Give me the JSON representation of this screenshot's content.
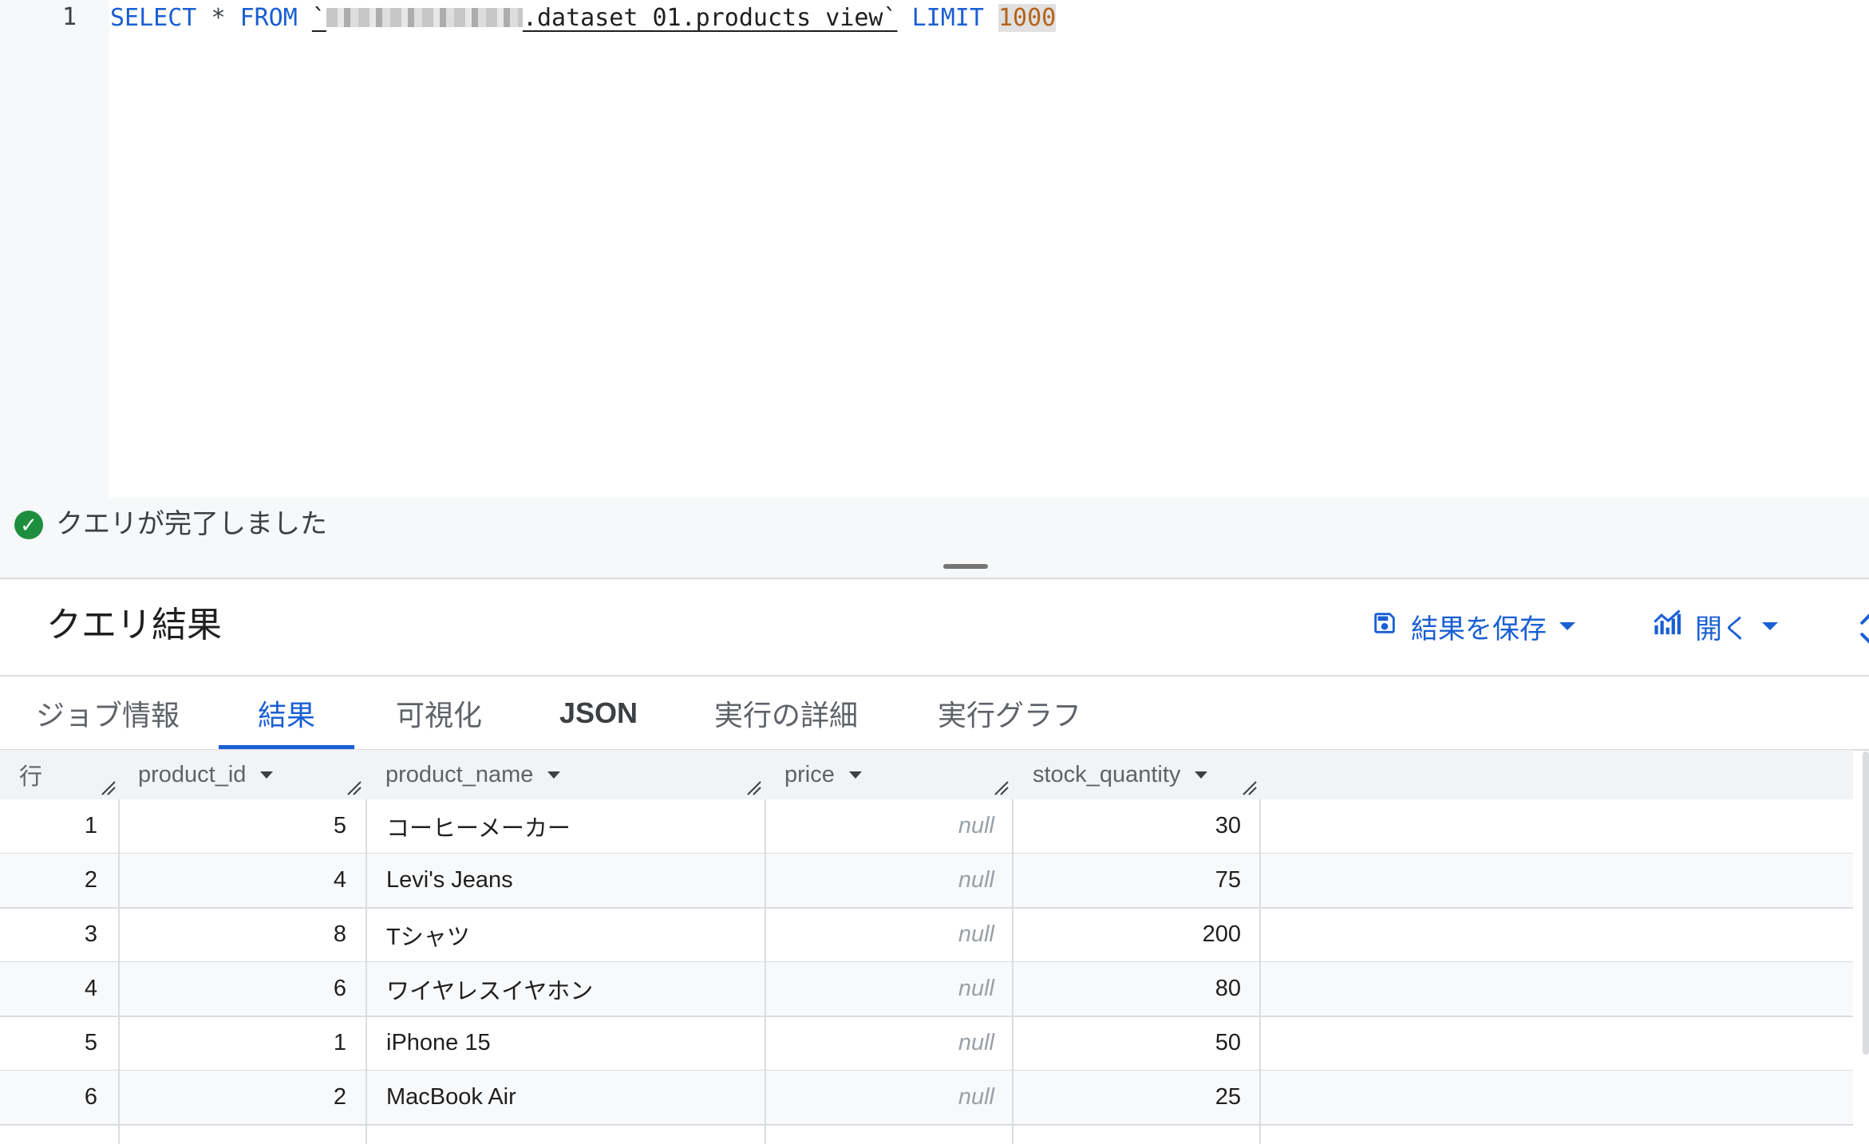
{
  "editor": {
    "line_number": "1",
    "kw_select": "SELECT",
    "star": "*",
    "kw_from": "FROM",
    "table_ref": ".dataset_01.products_view`",
    "kw_limit": "LIMIT",
    "limit_value": "1000"
  },
  "status": {
    "text": "クエリが完了しました"
  },
  "results": {
    "title": "クエリ結果",
    "save_label": "結果を保存",
    "open_label": "開く"
  },
  "tabs": [
    {
      "label": "ジョブ情報"
    },
    {
      "label": "結果"
    },
    {
      "label": "可視化"
    },
    {
      "label": "JSON"
    },
    {
      "label": "実行の詳細"
    },
    {
      "label": "実行グラフ"
    }
  ],
  "table": {
    "columns": [
      "行",
      "product_id",
      "product_name",
      "price",
      "stock_quantity"
    ],
    "rows": [
      {
        "row": "1",
        "product_id": "5",
        "product_name": "コーヒーメーカー",
        "price": "null",
        "stock_quantity": "30"
      },
      {
        "row": "2",
        "product_id": "4",
        "product_name": "Levi's Jeans",
        "price": "null",
        "stock_quantity": "75"
      },
      {
        "row": "3",
        "product_id": "8",
        "product_name": "Tシャツ",
        "price": "null",
        "stock_quantity": "200"
      },
      {
        "row": "4",
        "product_id": "6",
        "product_name": "ワイヤレスイヤホン",
        "price": "null",
        "stock_quantity": "80"
      },
      {
        "row": "5",
        "product_id": "1",
        "product_name": "iPhone 15",
        "price": "null",
        "stock_quantity": "50"
      },
      {
        "row": "6",
        "product_id": "2",
        "product_name": "MacBook Air",
        "price": "null",
        "stock_quantity": "25"
      }
    ]
  },
  "colors": {
    "accent": "#1a5fd3",
    "success": "#1e8e3e",
    "number_literal": "#b4631a"
  }
}
